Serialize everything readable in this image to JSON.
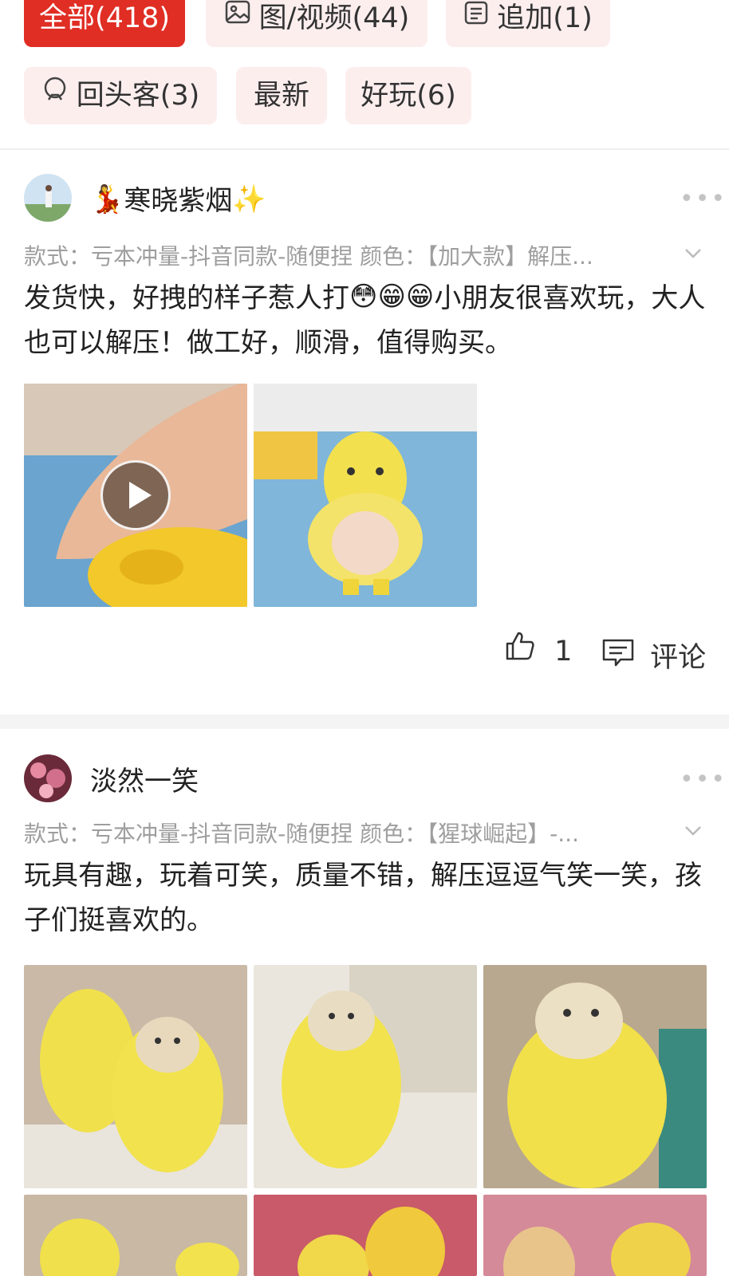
{
  "filters": {
    "row1": [
      {
        "label": "全部(418)",
        "icon": "",
        "active": true
      },
      {
        "label": "图/视频(44)",
        "icon": "image-icon",
        "active": false
      },
      {
        "label": "追加(1)",
        "icon": "append-icon",
        "active": false
      }
    ],
    "row2": [
      {
        "label": "回头客(3)",
        "icon": "repeat-customer-icon",
        "active": false
      },
      {
        "label": "最新",
        "icon": "",
        "active": false
      },
      {
        "label": "好玩(6)",
        "icon": "",
        "active": false
      }
    ]
  },
  "reviews": [
    {
      "username": "寒晓紫烟",
      "username_prefix_emoji": "💃",
      "username_suffix_emoji": "✨",
      "more": "•••",
      "variant": "款式：亏本冲量-抖音同款-随便捏  颜色：【加大款】解压...",
      "content_part1": "发货快，好拽的样子惹人打",
      "content_emojis": [
        "😳",
        "😁",
        "😁"
      ],
      "content_part2": "小朋友很喜欢玩，大人也可以解压！做工好，顺滑，值得购买。",
      "media": [
        {
          "type": "video",
          "icon": "play-icon"
        },
        {
          "type": "image"
        }
      ],
      "likes": "1",
      "comment_label": "评论"
    },
    {
      "username": "淡然一笑",
      "more": "•••",
      "variant": "款式：亏本冲量-抖音同款-随便捏  颜色：【猩球崛起】-...",
      "content": "玩具有趣，玩着可笑，质量不错，解压逗逗气笑一笑，孩子们挺喜欢的。",
      "media_count": 6
    }
  ],
  "colors": {
    "accent": "#e02e24",
    "chip_bg": "#fdeeee",
    "meta_text": "#9e9e9e"
  }
}
